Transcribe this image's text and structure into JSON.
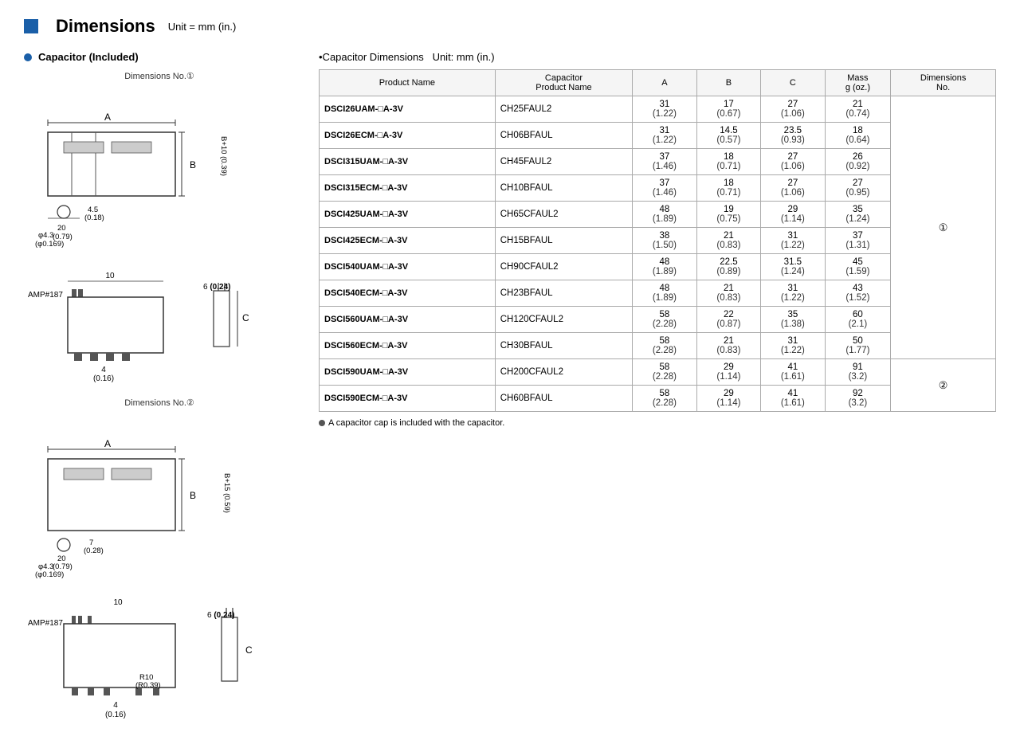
{
  "header": {
    "title": "Dimensions",
    "unit": "Unit = mm (in.)"
  },
  "left": {
    "section_title": "Capacitor (Included)",
    "dim_label_1": "Dimensions No.①",
    "dim_label_2": "Dimensions No.②"
  },
  "right": {
    "section_title": "•Capacitor Dimensions",
    "unit_label": "Unit: mm (in.)",
    "columns": {
      "product_name": "Product Name",
      "cap_product_name": "Capacitor\nProduct Name",
      "a": "A",
      "b": "B",
      "c": "C",
      "mass": "Mass\ng (oz.)",
      "dim_no": "Dimensions\nNo."
    },
    "rows": [
      {
        "product": "DSCI26UAM-□A-3V",
        "cap": "CH25FAUL2",
        "a": "31",
        "a2": "(1.22)",
        "b": "17",
        "b2": "(0.67)",
        "c": "27",
        "c2": "(1.06)",
        "mass": "21",
        "mass2": "(0.74)",
        "dim": "①"
      },
      {
        "product": "DSCI26ECM-□A-3V",
        "cap": "CH06BFAUL",
        "a": "31",
        "a2": "(1.22)",
        "b": "14.5",
        "b2": "(0.57)",
        "c": "23.5",
        "c2": "(0.93)",
        "mass": "18",
        "mass2": "(0.64)",
        "dim": "①"
      },
      {
        "product": "DSCI315UAM-□A-3V",
        "cap": "CH45FAUL2",
        "a": "37",
        "a2": "(1.46)",
        "b": "18",
        "b2": "(0.71)",
        "c": "27",
        "c2": "(1.06)",
        "mass": "26",
        "mass2": "(0.92)",
        "dim": "①"
      },
      {
        "product": "DSCI315ECM-□A-3V",
        "cap": "CH10BFAUL",
        "a": "37",
        "a2": "(1.46)",
        "b": "18",
        "b2": "(0.71)",
        "c": "27",
        "c2": "(1.06)",
        "mass": "27",
        "mass2": "(0.95)",
        "dim": "①"
      },
      {
        "product": "DSCI425UAM-□A-3V",
        "cap": "CH65CFAUL2",
        "a": "48",
        "a2": "(1.89)",
        "b": "19",
        "b2": "(0.75)",
        "c": "29",
        "c2": "(1.14)",
        "mass": "35",
        "mass2": "(1.24)",
        "dim": "①"
      },
      {
        "product": "DSCI425ECM-□A-3V",
        "cap": "CH15BFAUL",
        "a": "38",
        "a2": "(1.50)",
        "b": "21",
        "b2": "(0.83)",
        "c": "31",
        "c2": "(1.22)",
        "mass": "37",
        "mass2": "(1.31)",
        "dim": "①"
      },
      {
        "product": "DSCI540UAM-□A-3V",
        "cap": "CH90CFAUL2",
        "a": "48",
        "a2": "(1.89)",
        "b": "22.5",
        "b2": "(0.89)",
        "c": "31.5",
        "c2": "(1.24)",
        "mass": "45",
        "mass2": "(1.59)",
        "dim": "①"
      },
      {
        "product": "DSCI540ECM-□A-3V",
        "cap": "CH23BFAUL",
        "a": "48",
        "a2": "(1.89)",
        "b": "21",
        "b2": "(0.83)",
        "c": "31",
        "c2": "(1.22)",
        "mass": "43",
        "mass2": "(1.52)",
        "dim": "①"
      },
      {
        "product": "DSCI560UAM-□A-3V",
        "cap": "CH120CFAUL2",
        "a": "58",
        "a2": "(2.28)",
        "b": "22",
        "b2": "(0.87)",
        "c": "35",
        "c2": "(1.38)",
        "mass": "60",
        "mass2": "(2.1)",
        "dim": "①"
      },
      {
        "product": "DSCI560ECM-□A-3V",
        "cap": "CH30BFAUL",
        "a": "58",
        "a2": "(2.28)",
        "b": "21",
        "b2": "(0.83)",
        "c": "31",
        "c2": "(1.22)",
        "mass": "50",
        "mass2": "(1.77)",
        "dim": "①"
      },
      {
        "product": "DSCI590UAM-□A-3V",
        "cap": "CH200CFAUL2",
        "a": "58",
        "a2": "(2.28)",
        "b": "29",
        "b2": "(1.14)",
        "c": "41",
        "c2": "(1.61)",
        "mass": "91",
        "mass2": "(3.2)",
        "dim": "②"
      },
      {
        "product": "DSCI590ECM-□A-3V",
        "cap": "CH60BFAUL",
        "a": "58",
        "a2": "(2.28)",
        "b": "29",
        "b2": "(1.14)",
        "c": "41",
        "c2": "(1.61)",
        "mass": "92",
        "mass2": "(3.2)",
        "dim": "②"
      }
    ],
    "footnote": "A capacitor cap is included with the capacitor."
  }
}
